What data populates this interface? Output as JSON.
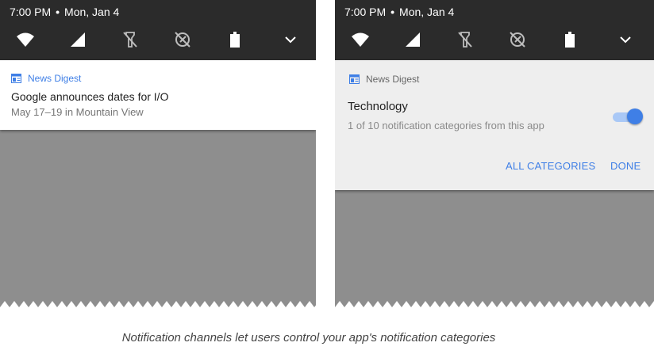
{
  "status_bar": {
    "time": "7:00 PM",
    "separator": "•",
    "date": "Mon, Jan 4",
    "quick_settings_icons": [
      "wifi-icon",
      "cellular-signal-icon",
      "flashlight-off-icon",
      "location-off-icon",
      "battery-icon",
      "chevron-down-icon"
    ]
  },
  "left_notification": {
    "app_name": "News Digest",
    "title": "Google announces dates for I/O",
    "subtitle": "May 17–19 in Mountain View"
  },
  "right_notification": {
    "app_name": "News Digest",
    "channel_title": "Technology",
    "channel_subtitle": "1 of 10 notification categories from this app",
    "toggle_on": true,
    "all_categories_label": "ALL CATEGORIES",
    "done_label": "DONE"
  },
  "caption": "Notification channels let users control your app's notification categories",
  "colors": {
    "accent": "#3f7fe6",
    "status_bar": "#2b2b2b",
    "shade": "#8e8e8e"
  }
}
